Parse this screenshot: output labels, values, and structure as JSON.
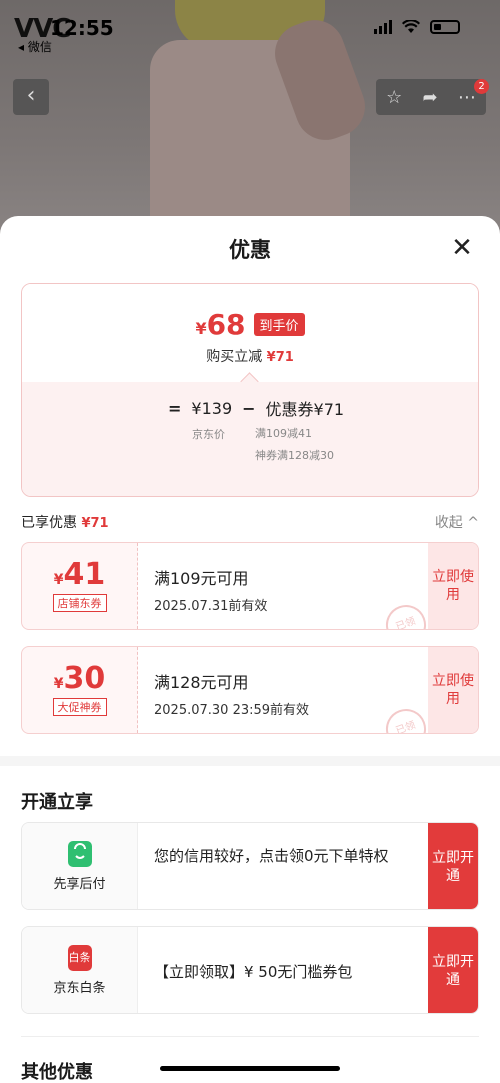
{
  "status": {
    "brand": "VVC",
    "time": "12:55",
    "back_app": "◂ 微信"
  },
  "colors": {
    "accent": "#e03a3a",
    "coupon_bg": "#fff6f6",
    "border": "#f2c5c5"
  },
  "header": {
    "title": "优惠",
    "close_icon": "close-icon"
  },
  "summary": {
    "final_currency": "¥",
    "final_amount": "68",
    "final_tag": "到手价",
    "reduce_label": "购买立减",
    "reduce_value": "¥71",
    "eq_sign": "=",
    "base_price": "¥139",
    "minus": "−",
    "coupon_total": "优惠券¥71",
    "base_label": "京东价",
    "coupon_detail_1": "满109减41",
    "coupon_detail_2": "神券满128减30"
  },
  "enjoyed": {
    "label": "已享优惠",
    "value": "¥71",
    "collapse": "收起 ^"
  },
  "coupons": [
    {
      "currency": "¥",
      "value": "41",
      "kind": "店铺东券",
      "condition": "满109元可用",
      "expiry": "2025.07.31前有效",
      "action": "立即使用",
      "stamp": "已领"
    },
    {
      "currency": "¥",
      "value": "30",
      "kind": "大促神券",
      "condition": "满128元可用",
      "expiry": "2025.07.30 23:59前有效",
      "action": "立即使用",
      "stamp": "已领"
    }
  ],
  "open_section": {
    "title": "开通立享",
    "offers": [
      {
        "name": "先享后付",
        "icon": "bag-icon",
        "icon_color": "#2fbf71",
        "text": "您的信用较好，点击领0元下单特权",
        "action": "立即开通"
      },
      {
        "name": "京东白条",
        "icon": "baitiao-icon",
        "icon_text": "白条",
        "icon_color": "#e03a3a",
        "text": "【立即领取】¥ 50无门槛券包",
        "action": "立即开通"
      }
    ]
  },
  "other_section": {
    "title": "其他优惠"
  }
}
